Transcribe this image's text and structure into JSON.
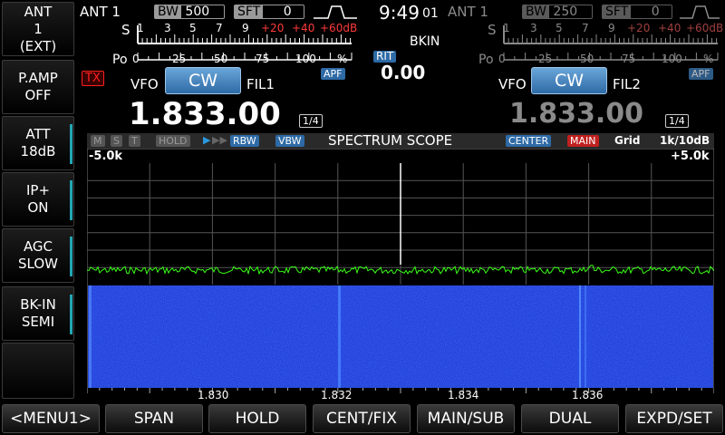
{
  "side_buttons": [
    {
      "line1": "ANT",
      "line2": "1",
      "line3": "(EXT)"
    },
    {
      "line1": "P.AMP",
      "line2": "OFF"
    },
    {
      "line1": "ATT",
      "line2": "18dB"
    },
    {
      "line1": "IP+",
      "line2": "ON"
    },
    {
      "line1": "AGC",
      "line2": "SLOW"
    },
    {
      "line1": "BK-IN",
      "line2": "SEMI"
    }
  ],
  "main": {
    "ant": "ANT 1",
    "bw_key": "BW",
    "bw_val": "500",
    "sft_key": "SFT",
    "sft_val": "0",
    "tx": "TX",
    "vfo": "VFO",
    "mode": "CW",
    "fil": "FIL1",
    "freq": "1.833.00",
    "step": "1/4"
  },
  "sub": {
    "ant": "ANT 1",
    "bw_key": "BW",
    "bw_val": "250",
    "sft_key": "SFT",
    "sft_val": "0",
    "vfo": "VFO",
    "mode": "CW",
    "fil": "FIL2",
    "freq": "1.833.00",
    "step": "1/4",
    "apf": "APF"
  },
  "center": {
    "time": "9:49",
    "seconds": "01",
    "bkin": "BKIN",
    "rit": "RIT",
    "rit_val": "0.00",
    "apf": "APF"
  },
  "meter": {
    "s": "S",
    "po": "Po",
    "s_ticks": [
      "1",
      "3",
      "5",
      "7",
      "9"
    ],
    "s_red": [
      "+20",
      "+40",
      "+60dB"
    ],
    "po_ticks": [
      "0",
      "25",
      "50",
      "75",
      "100",
      "%"
    ]
  },
  "scope": {
    "m": "M",
    "s": "S",
    "t": "T",
    "hold": "HOLD",
    "rbw": "RBW",
    "vbw": "VBW",
    "title": "SPECTRUM SCOPE",
    "center": "CENTER",
    "main": "MAIN",
    "grid": "Grid",
    "span": "1k/10dB",
    "left": "-5.0k",
    "right": "+5.0k",
    "freq_labels": [
      "1.830",
      "1.832",
      "1.834",
      "1.836"
    ]
  },
  "bottom_buttons": [
    "<MENU1>",
    "SPAN",
    "HOLD",
    "CENT/FIX",
    "MAIN/SUB",
    "DUAL",
    "EXPD/SET"
  ],
  "colors": {
    "accent": "#22a6b3",
    "waterfall": "#1030c8",
    "trace": "#39ff14",
    "alert": "#ff2020"
  }
}
